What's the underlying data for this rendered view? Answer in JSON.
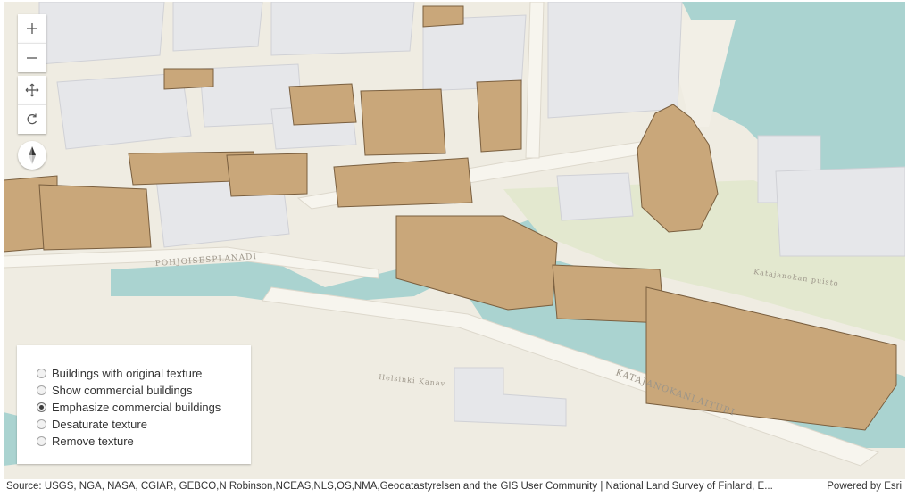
{
  "map": {
    "street_labels": [
      "POHJOISESPLANADI",
      "KATAJANOKANLAITURI",
      "Helsinki Kanav",
      "Katajanokan puisto"
    ]
  },
  "navigation": {
    "zoom_in_icon": "plus-icon",
    "zoom_out_icon": "minus-icon",
    "pan_icon": "move-icon",
    "rotate_icon": "rotate-icon",
    "compass_icon": "compass-icon"
  },
  "texture_panel": {
    "options": [
      {
        "label": "Buildings with original texture",
        "selected": false
      },
      {
        "label": "Show commercial buildings",
        "selected": false
      },
      {
        "label": "Emphasize commercial buildings",
        "selected": true
      },
      {
        "label": "Desaturate texture",
        "selected": false
      },
      {
        "label": "Remove texture",
        "selected": false
      }
    ]
  },
  "attribution": {
    "source": "Source: USGS, NGA, NASA, CGIAR, GEBCO,N Robinson,NCEAS,NLS,OS,NMA,Geodatastyrelsen and the GIS User Community | National Land Survey of Finland, E...",
    "powered_by": "Powered by Esri"
  },
  "colors": {
    "water": "#aad3d0",
    "park": "#e3e8cf",
    "land": "#efece2",
    "building_plain": "#e6e7ea",
    "building_textured": "#c9a77a"
  }
}
